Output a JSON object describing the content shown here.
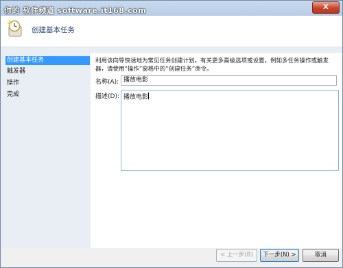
{
  "watermark": "你的 软件频道 software.it168.com",
  "window": {
    "close_label": "X"
  },
  "header": {
    "title": "创建基本任务",
    "icon": "clock-task-icon"
  },
  "nav": {
    "items": [
      {
        "label": "创建基本任务",
        "selected": true
      },
      {
        "label": "触发器",
        "selected": false
      },
      {
        "label": "操作",
        "selected": false
      },
      {
        "label": "完成",
        "selected": false
      }
    ]
  },
  "content": {
    "intro": "利用该向导快速地为常见任务创建计划。有关更多高级选项或设置，例如多任务操作或触发器，请使用“操作”窗格中的“创建任务”命令。",
    "name_label": "名称(A):",
    "name_value": "播放电影",
    "desc_label": "描述(D):",
    "desc_value": "播放电影"
  },
  "footer": {
    "back_label": "< 上一步(B)",
    "next_label": "下一步(N) >",
    "cancel_label": "取消"
  }
}
